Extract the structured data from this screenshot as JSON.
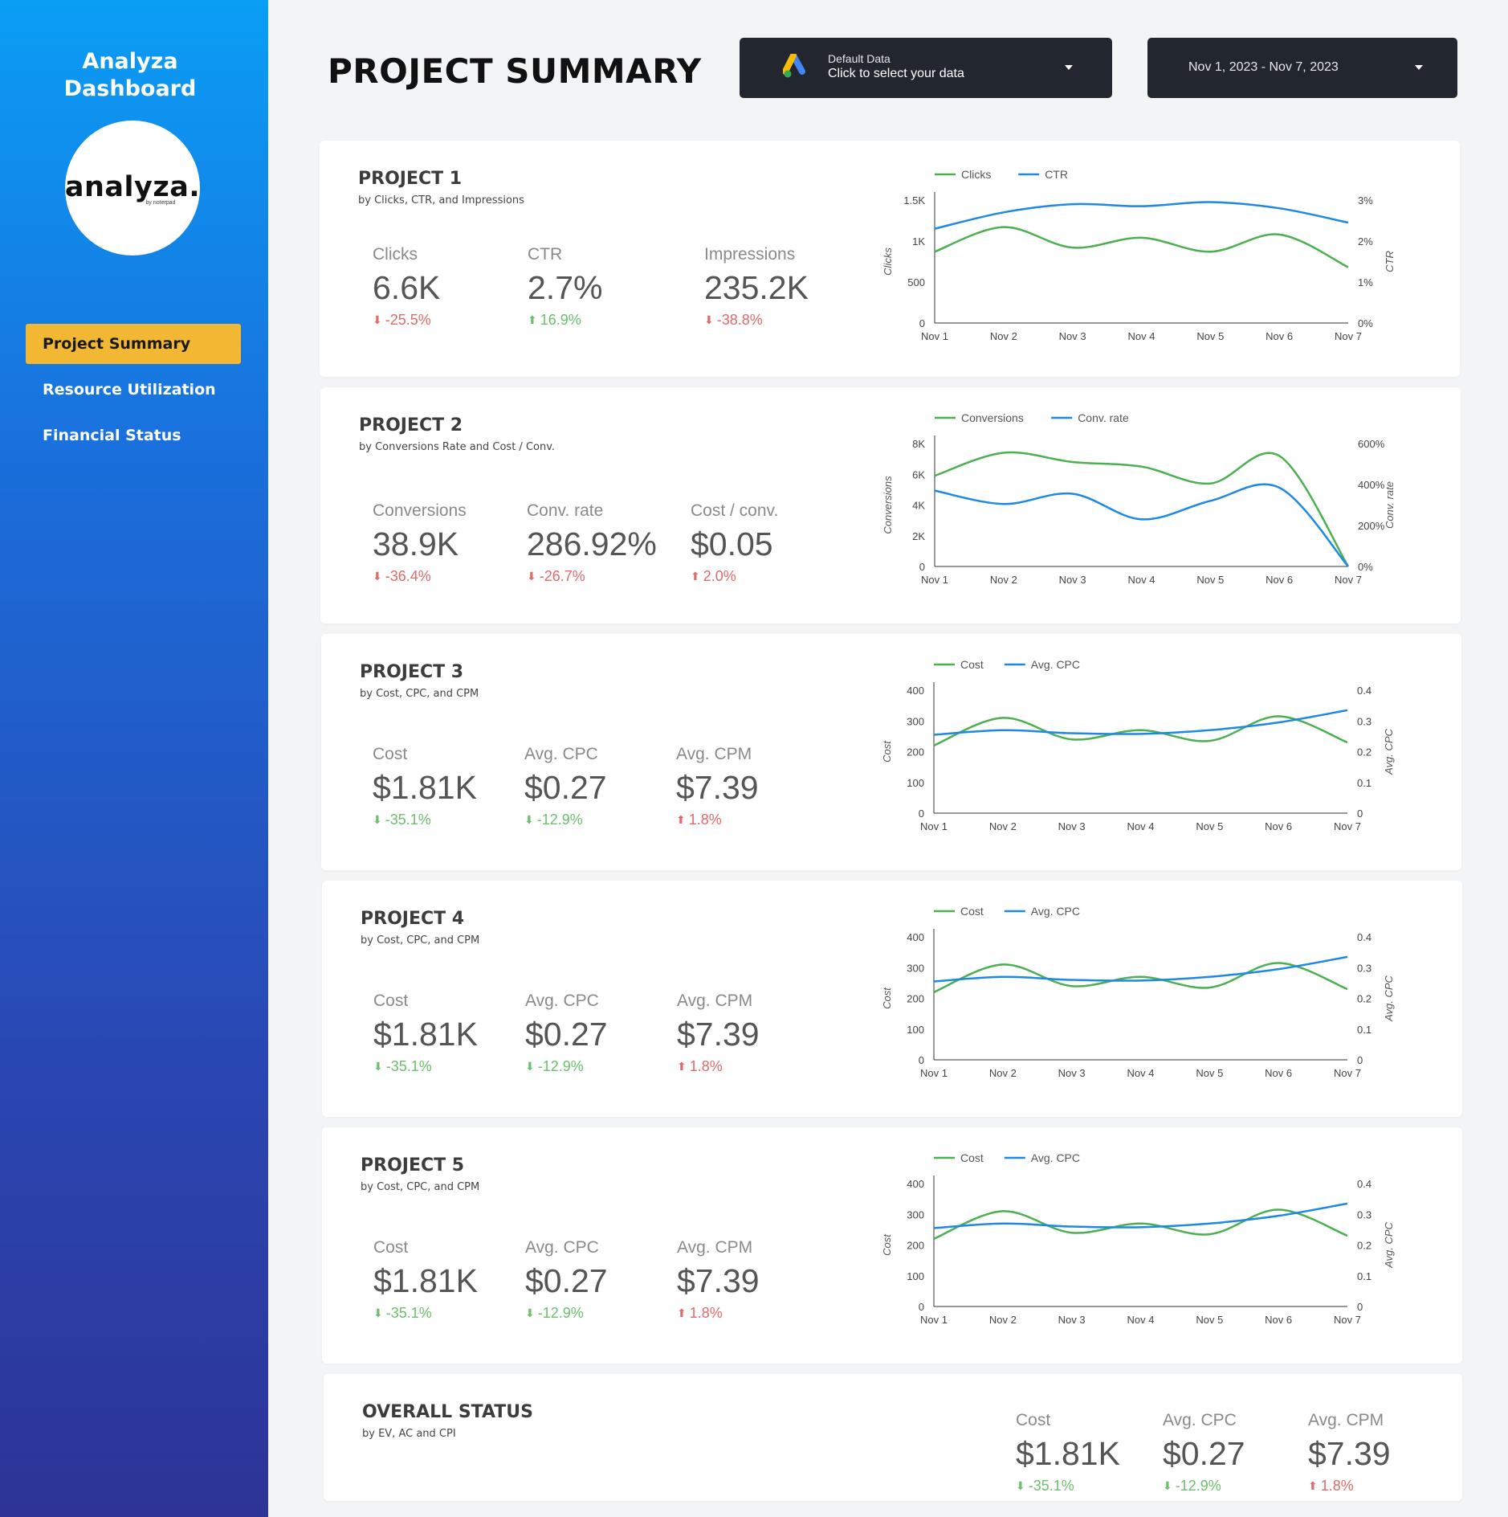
{
  "sidebar": {
    "brand_line1": "Analyza",
    "brand_line2": "Dashboard",
    "logo_text": "analyza.",
    "logo_sub": "by noterpad",
    "nav": [
      {
        "label": "Project Summary",
        "active": true
      },
      {
        "label": "Resource Utilization",
        "active": false
      },
      {
        "label": "Financial Status",
        "active": false
      }
    ]
  },
  "header": {
    "title": "PROJECT SUMMARY",
    "data_source": {
      "small": "Default Data",
      "big": "Click to select your data"
    },
    "date_range": "Nov 1, 2023 - Nov 7, 2023"
  },
  "colors": {
    "green": "#4caf50",
    "blue": "#1e88e5",
    "good": "#6cbf6c",
    "bad": "#e06a6a",
    "accent": "#f2b733"
  },
  "projects": [
    {
      "title": "PROJECT 1",
      "subtitle": "by Clicks, CTR, and Impressions",
      "metrics": [
        {
          "label": "Clicks",
          "value": "6.6K",
          "change": "-25.5%",
          "dir": "down",
          "status": "bad"
        },
        {
          "label": "CTR",
          "value": "2.7%",
          "change": "16.9%",
          "dir": "up",
          "status": "good"
        },
        {
          "label": "Impressions",
          "value": "235.2K",
          "change": "-38.8%",
          "dir": "down",
          "status": "bad"
        }
      ]
    },
    {
      "title": "PROJECT 2",
      "subtitle": "by Conversions Rate and Cost / Conv.",
      "metrics": [
        {
          "label": "Conversions",
          "value": "38.9K",
          "change": "-36.4%",
          "dir": "down",
          "status": "bad"
        },
        {
          "label": "Conv. rate",
          "value": "286.92%",
          "change": "-26.7%",
          "dir": "down",
          "status": "bad"
        },
        {
          "label": "Cost / conv.",
          "value": "$0.05",
          "change": "2.0%",
          "dir": "up",
          "status": "bad"
        }
      ]
    },
    {
      "title": "PROJECT 3",
      "subtitle": "by Cost, CPC, and CPM",
      "metrics": [
        {
          "label": "Cost",
          "value": "$1.81K",
          "change": "-35.1%",
          "dir": "down",
          "status": "good"
        },
        {
          "label": "Avg. CPC",
          "value": "$0.27",
          "change": "-12.9%",
          "dir": "down",
          "status": "good"
        },
        {
          "label": "Avg. CPM",
          "value": "$7.39",
          "change": "1.8%",
          "dir": "up",
          "status": "bad"
        }
      ]
    },
    {
      "title": "PROJECT 4",
      "subtitle": "by Cost, CPC, and CPM",
      "metrics": [
        {
          "label": "Cost",
          "value": "$1.81K",
          "change": "-35.1%",
          "dir": "down",
          "status": "good"
        },
        {
          "label": "Avg. CPC",
          "value": "$0.27",
          "change": "-12.9%",
          "dir": "down",
          "status": "good"
        },
        {
          "label": "Avg. CPM",
          "value": "$7.39",
          "change": "1.8%",
          "dir": "up",
          "status": "bad"
        }
      ]
    },
    {
      "title": "PROJECT 5",
      "subtitle": "by Cost, CPC, and CPM",
      "metrics": [
        {
          "label": "Cost",
          "value": "$1.81K",
          "change": "-35.1%",
          "dir": "down",
          "status": "good"
        },
        {
          "label": "Avg. CPC",
          "value": "$0.27",
          "change": "-12.9%",
          "dir": "down",
          "status": "good"
        },
        {
          "label": "Avg. CPM",
          "value": "$7.39",
          "change": "1.8%",
          "dir": "up",
          "status": "bad"
        }
      ]
    }
  ],
  "overall": {
    "title": "OVERALL STATUS",
    "subtitle": "by EV, AC and CPI",
    "metrics": [
      {
        "label": "Cost",
        "value": "$1.81K",
        "change": "-35.1%",
        "dir": "down",
        "status": "good"
      },
      {
        "label": "Avg. CPC",
        "value": "$0.27",
        "change": "-12.9%",
        "dir": "down",
        "status": "good"
      },
      {
        "label": "Avg. CPM",
        "value": "$7.39",
        "change": "1.8%",
        "dir": "up",
        "status": "bad"
      }
    ]
  },
  "chart_data": [
    {
      "type": "line",
      "categories": [
        "Nov 1",
        "Nov 2",
        "Nov 3",
        "Nov 4",
        "Nov 5",
        "Nov 6",
        "Nov 7"
      ],
      "left_axis": {
        "label": "Clicks",
        "ticks": [
          "0",
          "500",
          "1K",
          "1.5K"
        ],
        "min": 0,
        "max": 1500
      },
      "right_axis": {
        "label": "CTR",
        "ticks": [
          "0%",
          "1%",
          "2%",
          "3%"
        ],
        "min": 0,
        "max": 3
      },
      "series": [
        {
          "name": "Clicks",
          "axis": "left",
          "color": "#4caf50",
          "values": [
            870,
            1170,
            920,
            1040,
            870,
            1080,
            680
          ]
        },
        {
          "name": "CTR",
          "axis": "right",
          "color": "#1e88e5",
          "values": [
            2.3,
            2.7,
            2.9,
            2.85,
            2.95,
            2.8,
            2.45
          ]
        }
      ]
    },
    {
      "type": "line",
      "categories": [
        "Nov 1",
        "Nov 2",
        "Nov 3",
        "Nov 4",
        "Nov 5",
        "Nov 6",
        "Nov 7"
      ],
      "left_axis": {
        "label": "Conversions",
        "ticks": [
          "0",
          "2K",
          "4K",
          "6K",
          "8K"
        ],
        "min": 0,
        "max": 8000
      },
      "right_axis": {
        "label": "Conv. rate",
        "ticks": [
          "0%",
          "200%",
          "400%",
          "600%"
        ],
        "min": 0,
        "max": 600
      },
      "series": [
        {
          "name": "Conversions",
          "axis": "left",
          "color": "#4caf50",
          "values": [
            5900,
            7400,
            6800,
            6500,
            5400,
            7200,
            0
          ]
        },
        {
          "name": "Conv. rate",
          "axis": "right",
          "color": "#1e88e5",
          "values": [
            370,
            305,
            355,
            230,
            320,
            385,
            0
          ]
        }
      ]
    },
    {
      "type": "line",
      "categories": [
        "Nov 1",
        "Nov 2",
        "Nov 3",
        "Nov 4",
        "Nov 5",
        "Nov 6",
        "Nov 7"
      ],
      "left_axis": {
        "label": "Cost",
        "ticks": [
          "0",
          "100",
          "200",
          "300",
          "400"
        ],
        "min": 0,
        "max": 400
      },
      "right_axis": {
        "label": "Avg. CPC",
        "ticks": [
          "0",
          "0.1",
          "0.2",
          "0.3",
          "0.4"
        ],
        "min": 0,
        "max": 0.4
      },
      "series": [
        {
          "name": "Cost",
          "axis": "left",
          "color": "#4caf50",
          "values": [
            220,
            310,
            240,
            270,
            235,
            315,
            230
          ]
        },
        {
          "name": "Avg. CPC",
          "axis": "right",
          "color": "#1e88e5",
          "values": [
            0.255,
            0.27,
            0.26,
            0.258,
            0.27,
            0.295,
            0.335
          ]
        }
      ]
    },
    {
      "type": "line",
      "categories": [
        "Nov 1",
        "Nov 2",
        "Nov 3",
        "Nov 4",
        "Nov 5",
        "Nov 6",
        "Nov 7"
      ],
      "left_axis": {
        "label": "Cost",
        "ticks": [
          "0",
          "100",
          "200",
          "300",
          "400"
        ],
        "min": 0,
        "max": 400
      },
      "right_axis": {
        "label": "Avg. CPC",
        "ticks": [
          "0",
          "0.1",
          "0.2",
          "0.3",
          "0.4"
        ],
        "min": 0,
        "max": 0.4
      },
      "series": [
        {
          "name": "Cost",
          "axis": "left",
          "color": "#4caf50",
          "values": [
            220,
            310,
            240,
            270,
            235,
            315,
            230
          ]
        },
        {
          "name": "Avg. CPC",
          "axis": "right",
          "color": "#1e88e5",
          "values": [
            0.255,
            0.27,
            0.26,
            0.258,
            0.27,
            0.295,
            0.335
          ]
        }
      ]
    },
    {
      "type": "line",
      "categories": [
        "Nov 1",
        "Nov 2",
        "Nov 3",
        "Nov 4",
        "Nov 5",
        "Nov 6",
        "Nov 7"
      ],
      "left_axis": {
        "label": "Cost",
        "ticks": [
          "0",
          "100",
          "200",
          "300",
          "400"
        ],
        "min": 0,
        "max": 400
      },
      "right_axis": {
        "label": "Avg. CPC",
        "ticks": [
          "0",
          "0.1",
          "0.2",
          "0.3",
          "0.4"
        ],
        "min": 0,
        "max": 0.4
      },
      "series": [
        {
          "name": "Cost",
          "axis": "left",
          "color": "#4caf50",
          "values": [
            220,
            310,
            240,
            270,
            235,
            315,
            230
          ]
        },
        {
          "name": "Avg. CPC",
          "axis": "right",
          "color": "#1e88e5",
          "values": [
            0.255,
            0.27,
            0.26,
            0.258,
            0.27,
            0.295,
            0.335
          ]
        }
      ]
    }
  ]
}
